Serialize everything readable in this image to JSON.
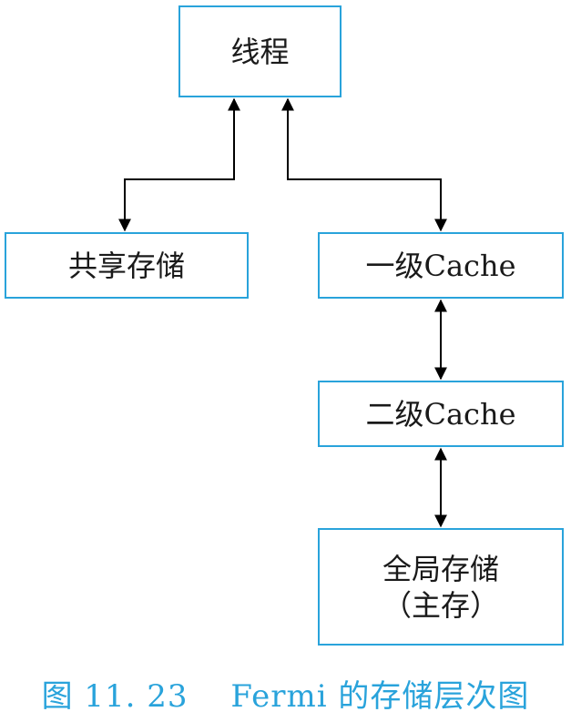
{
  "nodes": {
    "thread": "线程",
    "shared_memory": "共享存储",
    "l1_cache": "一级Cache",
    "l2_cache": "二级Cache",
    "global_memory_line1": "全局存储",
    "global_memory_line2": "（主存）"
  },
  "caption": "图 11. 23　 Fermi 的存储层次图",
  "colors": {
    "box_border": "#29a3db",
    "caption": "#29a3db",
    "arrow": "#000000"
  }
}
